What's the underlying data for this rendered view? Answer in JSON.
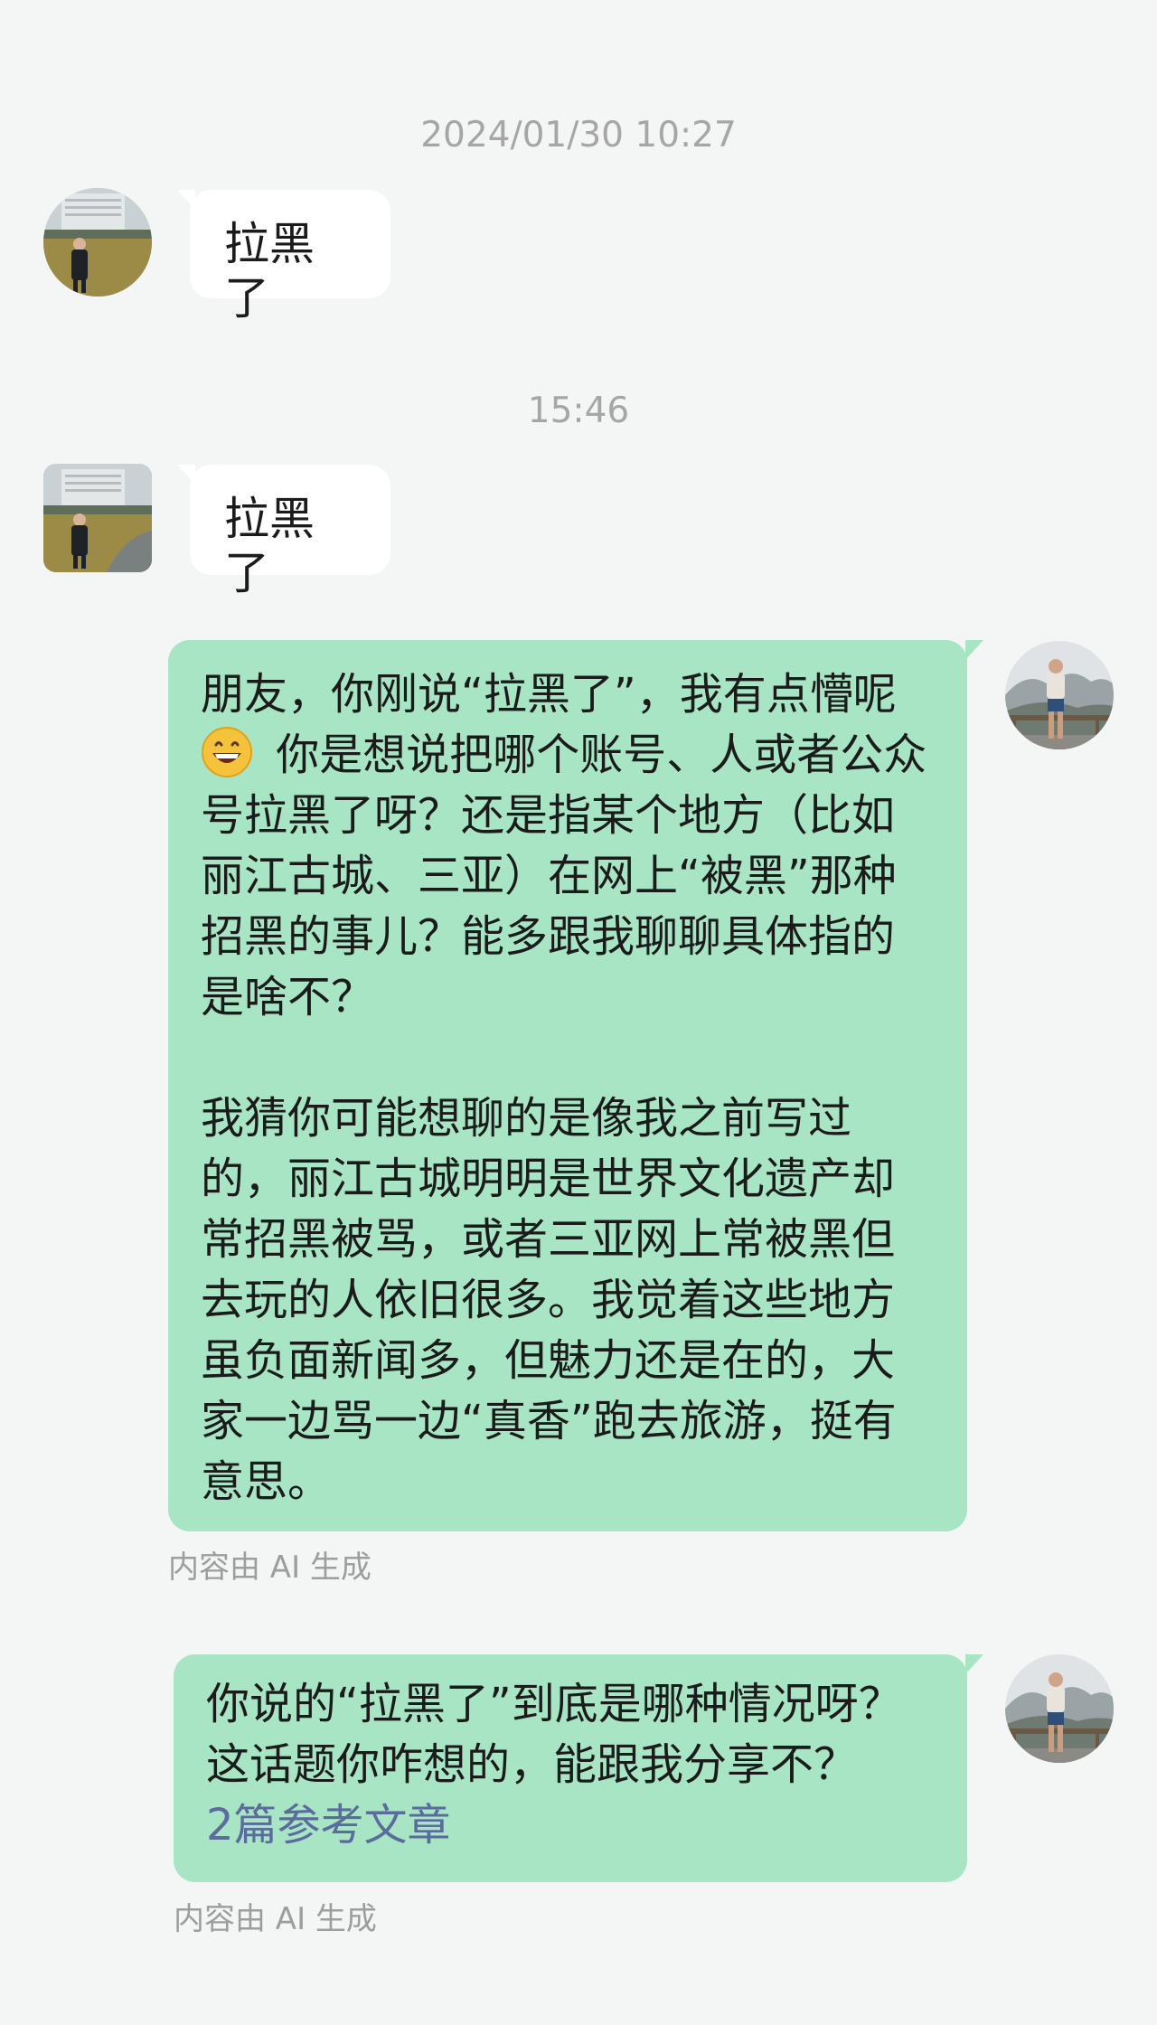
{
  "chat": {
    "timestamps": [
      "2024/01/30 10:27",
      "15:46"
    ],
    "incoming": [
      {
        "text": "拉黑了",
        "avatar": "user-avatar-photo"
      },
      {
        "text": "拉黑了",
        "avatar": "user-avatar-photo"
      }
    ],
    "reply1": {
      "para1_before_emoji": "朋友，你刚说“拉黑了”，我有点懵呢",
      "emoji": "grinning-face-emoji",
      "para1_after_emoji": " 你是想说把哪个账号、人或者公众号拉黑了呀？还是指某个地方（比如丽江古城、三亚）在网上“被黑”那种招黑的事儿？能多跟我聊聊具体指的是啥不？",
      "para2": "我猜你可能想聊的是像我之前写过的，丽江古城明明是世界文化遗产却常招黑被骂，或者三亚网上常被黑但去玩的人依旧很多。我觉着这些地方虽负面新闻多，但魅力还是在的，大家一边骂一边“真香”跑去旅游，挺有意思。",
      "ai_note": "内容由 AI 生成"
    },
    "reply2": {
      "text": "你说的“拉黑了”到底是哪种情况呀？这话题你咋想的，能跟我分享不？",
      "ref_link": "2篇参考文章",
      "ai_note": "内容由 AI 生成"
    }
  },
  "colors": {
    "background": "#f4f5f5",
    "incoming_bubble": "#ffffff",
    "outgoing_bubble": "#a7e5c5",
    "timestamp_text": "#a6a6a6",
    "link_text": "#5b6b9c"
  }
}
